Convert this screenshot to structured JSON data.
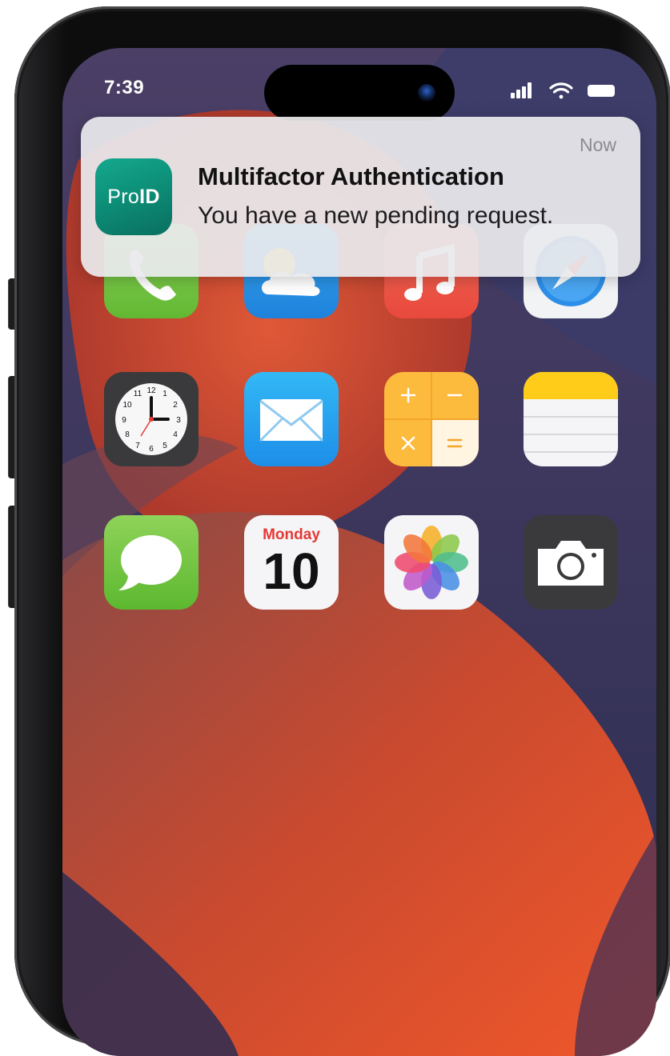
{
  "status_bar": {
    "time": "7:39"
  },
  "notification": {
    "app_name_prefix": "Pro",
    "app_name_bold": "ID",
    "timestamp": "Now",
    "title": "Multifactor Authentication",
    "message": "You have a new pending request."
  },
  "home_screen": {
    "calendar_day": "Monday",
    "calendar_date": "10",
    "clock_numerals": [
      "12",
      "1",
      "2",
      "3",
      "4",
      "5",
      "6",
      "7",
      "8",
      "9",
      "10",
      "11"
    ]
  },
  "apps": [
    {
      "icon": "phone-icon"
    },
    {
      "icon": "weather-icon"
    },
    {
      "icon": "music-icon"
    },
    {
      "icon": "safari-icon"
    },
    {
      "icon": "clock-icon"
    },
    {
      "icon": "mail-icon"
    },
    {
      "icon": "calculator-icon"
    },
    {
      "icon": "notes-icon"
    },
    {
      "icon": "messages-icon"
    },
    {
      "icon": "calendar-icon"
    },
    {
      "icon": "photos-icon"
    },
    {
      "icon": "camera-icon"
    }
  ],
  "colors": {
    "proid_brand": "#0c8a74",
    "notification_background": "#e9e9ed",
    "wallpaper_orange": "#e8512b",
    "wallpaper_navy": "#2c2d52"
  }
}
